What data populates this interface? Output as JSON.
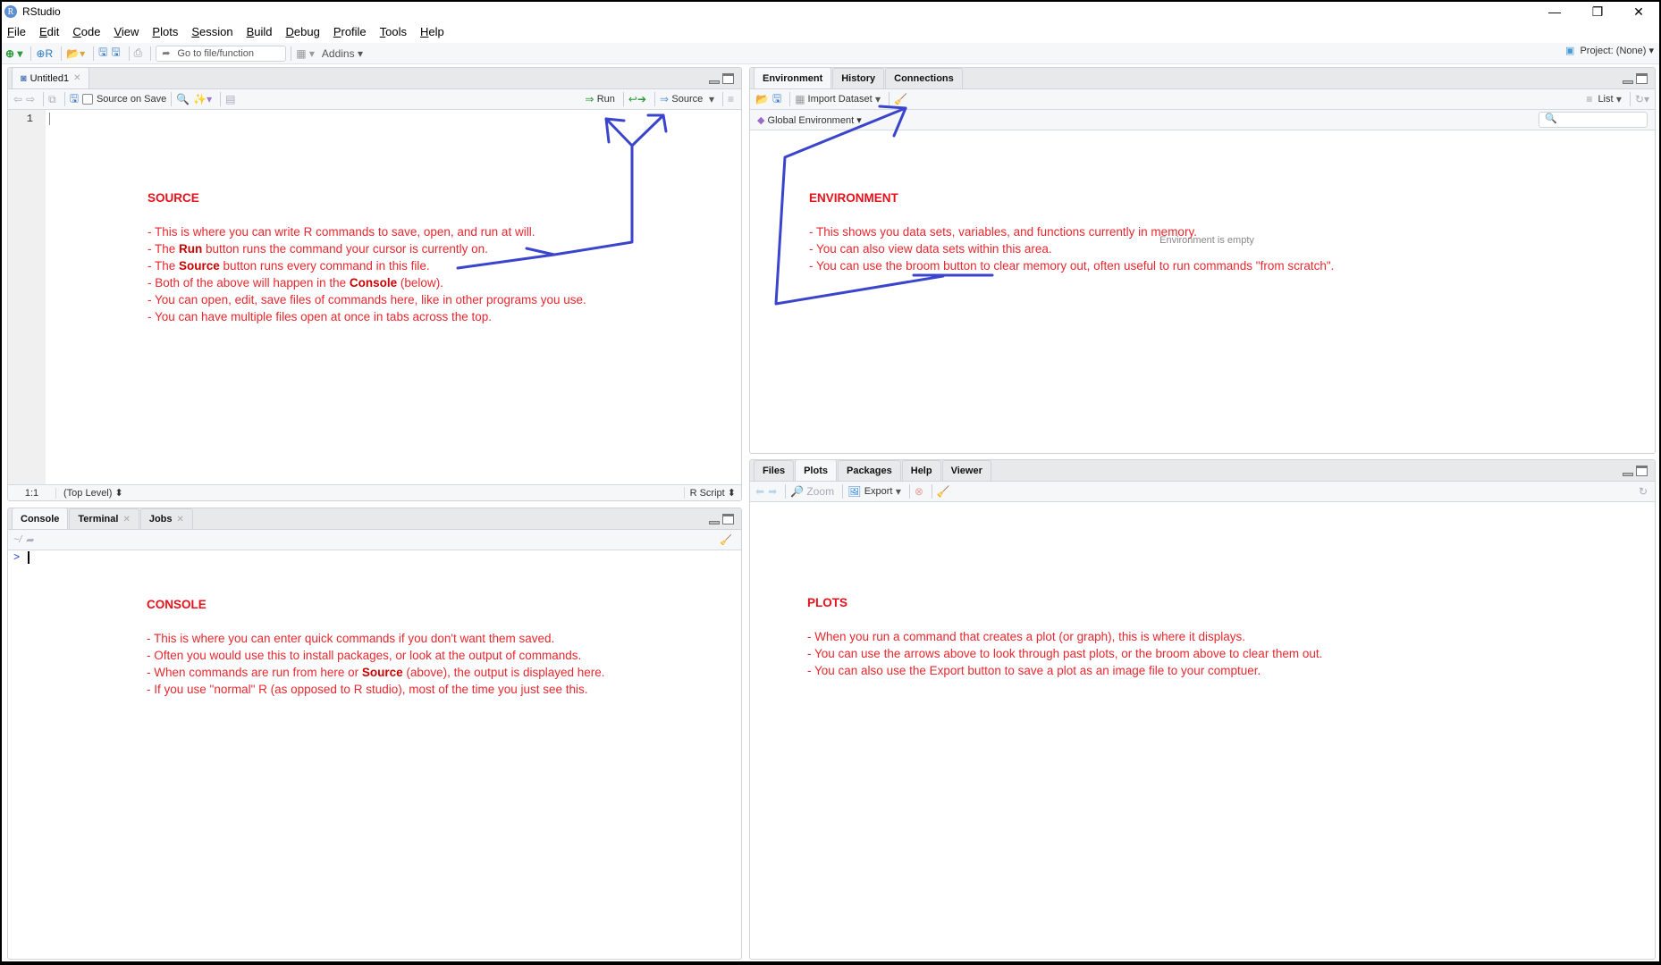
{
  "window": {
    "title": "RStudio",
    "controls": {
      "minimize": "—",
      "restore": "❐",
      "close": "✕"
    }
  },
  "menu": [
    {
      "label": "File",
      "accel": "F",
      "rest": "ile"
    },
    {
      "label": "Edit",
      "accel": "E",
      "rest": "dit"
    },
    {
      "label": "Code",
      "accel": "C",
      "rest": "ode"
    },
    {
      "label": "View",
      "accel": "V",
      "rest": "iew"
    },
    {
      "label": "Plots",
      "accel": "P",
      "rest": "lots"
    },
    {
      "label": "Session",
      "accel": "S",
      "rest": "ession"
    },
    {
      "label": "Build",
      "accel": "B",
      "rest": "uild"
    },
    {
      "label": "Debug",
      "accel": "D",
      "rest": "ebug"
    },
    {
      "label": "Profile",
      "accel": "P",
      "rest": "rofile"
    },
    {
      "label": "Tools",
      "accel": "T",
      "rest": "ools"
    },
    {
      "label": "Help",
      "accel": "H",
      "rest": "elp"
    }
  ],
  "toolbar": {
    "goto_placeholder": "Go to file/function",
    "addins": "Addins",
    "project": "Project: (None)"
  },
  "source": {
    "tab": "Untitled1",
    "source_on_save": "Source on Save",
    "run": "Run",
    "source_btn": "Source",
    "line_number": "1",
    "position": "1:1",
    "scope": "(Top Level)",
    "file_type": "R Script"
  },
  "console": {
    "tabs": [
      "Console",
      "Terminal",
      "Jobs"
    ],
    "path": "~/",
    "prompt": ">"
  },
  "environment": {
    "tabs": [
      "Environment",
      "History",
      "Connections"
    ],
    "import_dataset": "Import Dataset",
    "view_mode": "List",
    "scope": "Global Environment",
    "empty_message": "Environment is empty",
    "search_placeholder": ""
  },
  "files": {
    "tabs": [
      "Files",
      "Plots",
      "Packages",
      "Help",
      "Viewer"
    ],
    "active_tab": "Plots",
    "zoom": "Zoom",
    "export": "Export"
  },
  "annotations": {
    "source": {
      "heading": "SOURCE",
      "lines": [
        {
          "pre": "- This is where you can write R commands to save, open, and run at will.",
          "bold": "",
          "post": ""
        },
        {
          "pre": "- The ",
          "bold": "Run",
          "post": " button runs the command your cursor is currently on."
        },
        {
          "pre": "- The ",
          "bold": "Source",
          "post": " button runs every command in this file."
        },
        {
          "pre": "- Both of the above will happen in the ",
          "bold": "Console",
          "post": " (below)."
        },
        {
          "pre": "- You can open, edit, save files of commands here, like in other programs you use.",
          "bold": "",
          "post": ""
        },
        {
          "pre": "- You can have multiple files open at once in tabs across the top.",
          "bold": "",
          "post": ""
        }
      ]
    },
    "environment": {
      "heading": "ENVIRONMENT",
      "lines": [
        "- This shows you data sets, variables, and functions currently in memory.",
        "- You can also view data sets within this area.",
        "- You can use the broom button to clear memory out, often useful to run commands \"from scratch\"."
      ]
    },
    "console": {
      "heading": "CONSOLE",
      "lines": [
        {
          "pre": "- This is where you can enter quick commands if you don't want them saved.",
          "bold": "",
          "post": ""
        },
        {
          "pre": "- Often you would use this to install packages, or look at the output of commands.",
          "bold": "",
          "post": ""
        },
        {
          "pre": "- When commands are run from here or ",
          "bold": "Source",
          "post": " (above), the output is displayed here."
        },
        {
          "pre": "- If you use \"normal\" R (as opposed to R studio), most of the time you just see this.",
          "bold": "",
          "post": ""
        }
      ]
    },
    "plots": {
      "heading": "PLOTS",
      "lines": [
        "- When you run a command that creates a plot (or graph), this is where it displays.",
        "- You can use the arrows above to look through past plots, or the broom above to clear them out.",
        "- You can also use the Export button to save a plot as an image file to your comptuer."
      ]
    }
  },
  "colors": {
    "annotation_text": "#e8272e",
    "arrow": "#3a44cc"
  }
}
